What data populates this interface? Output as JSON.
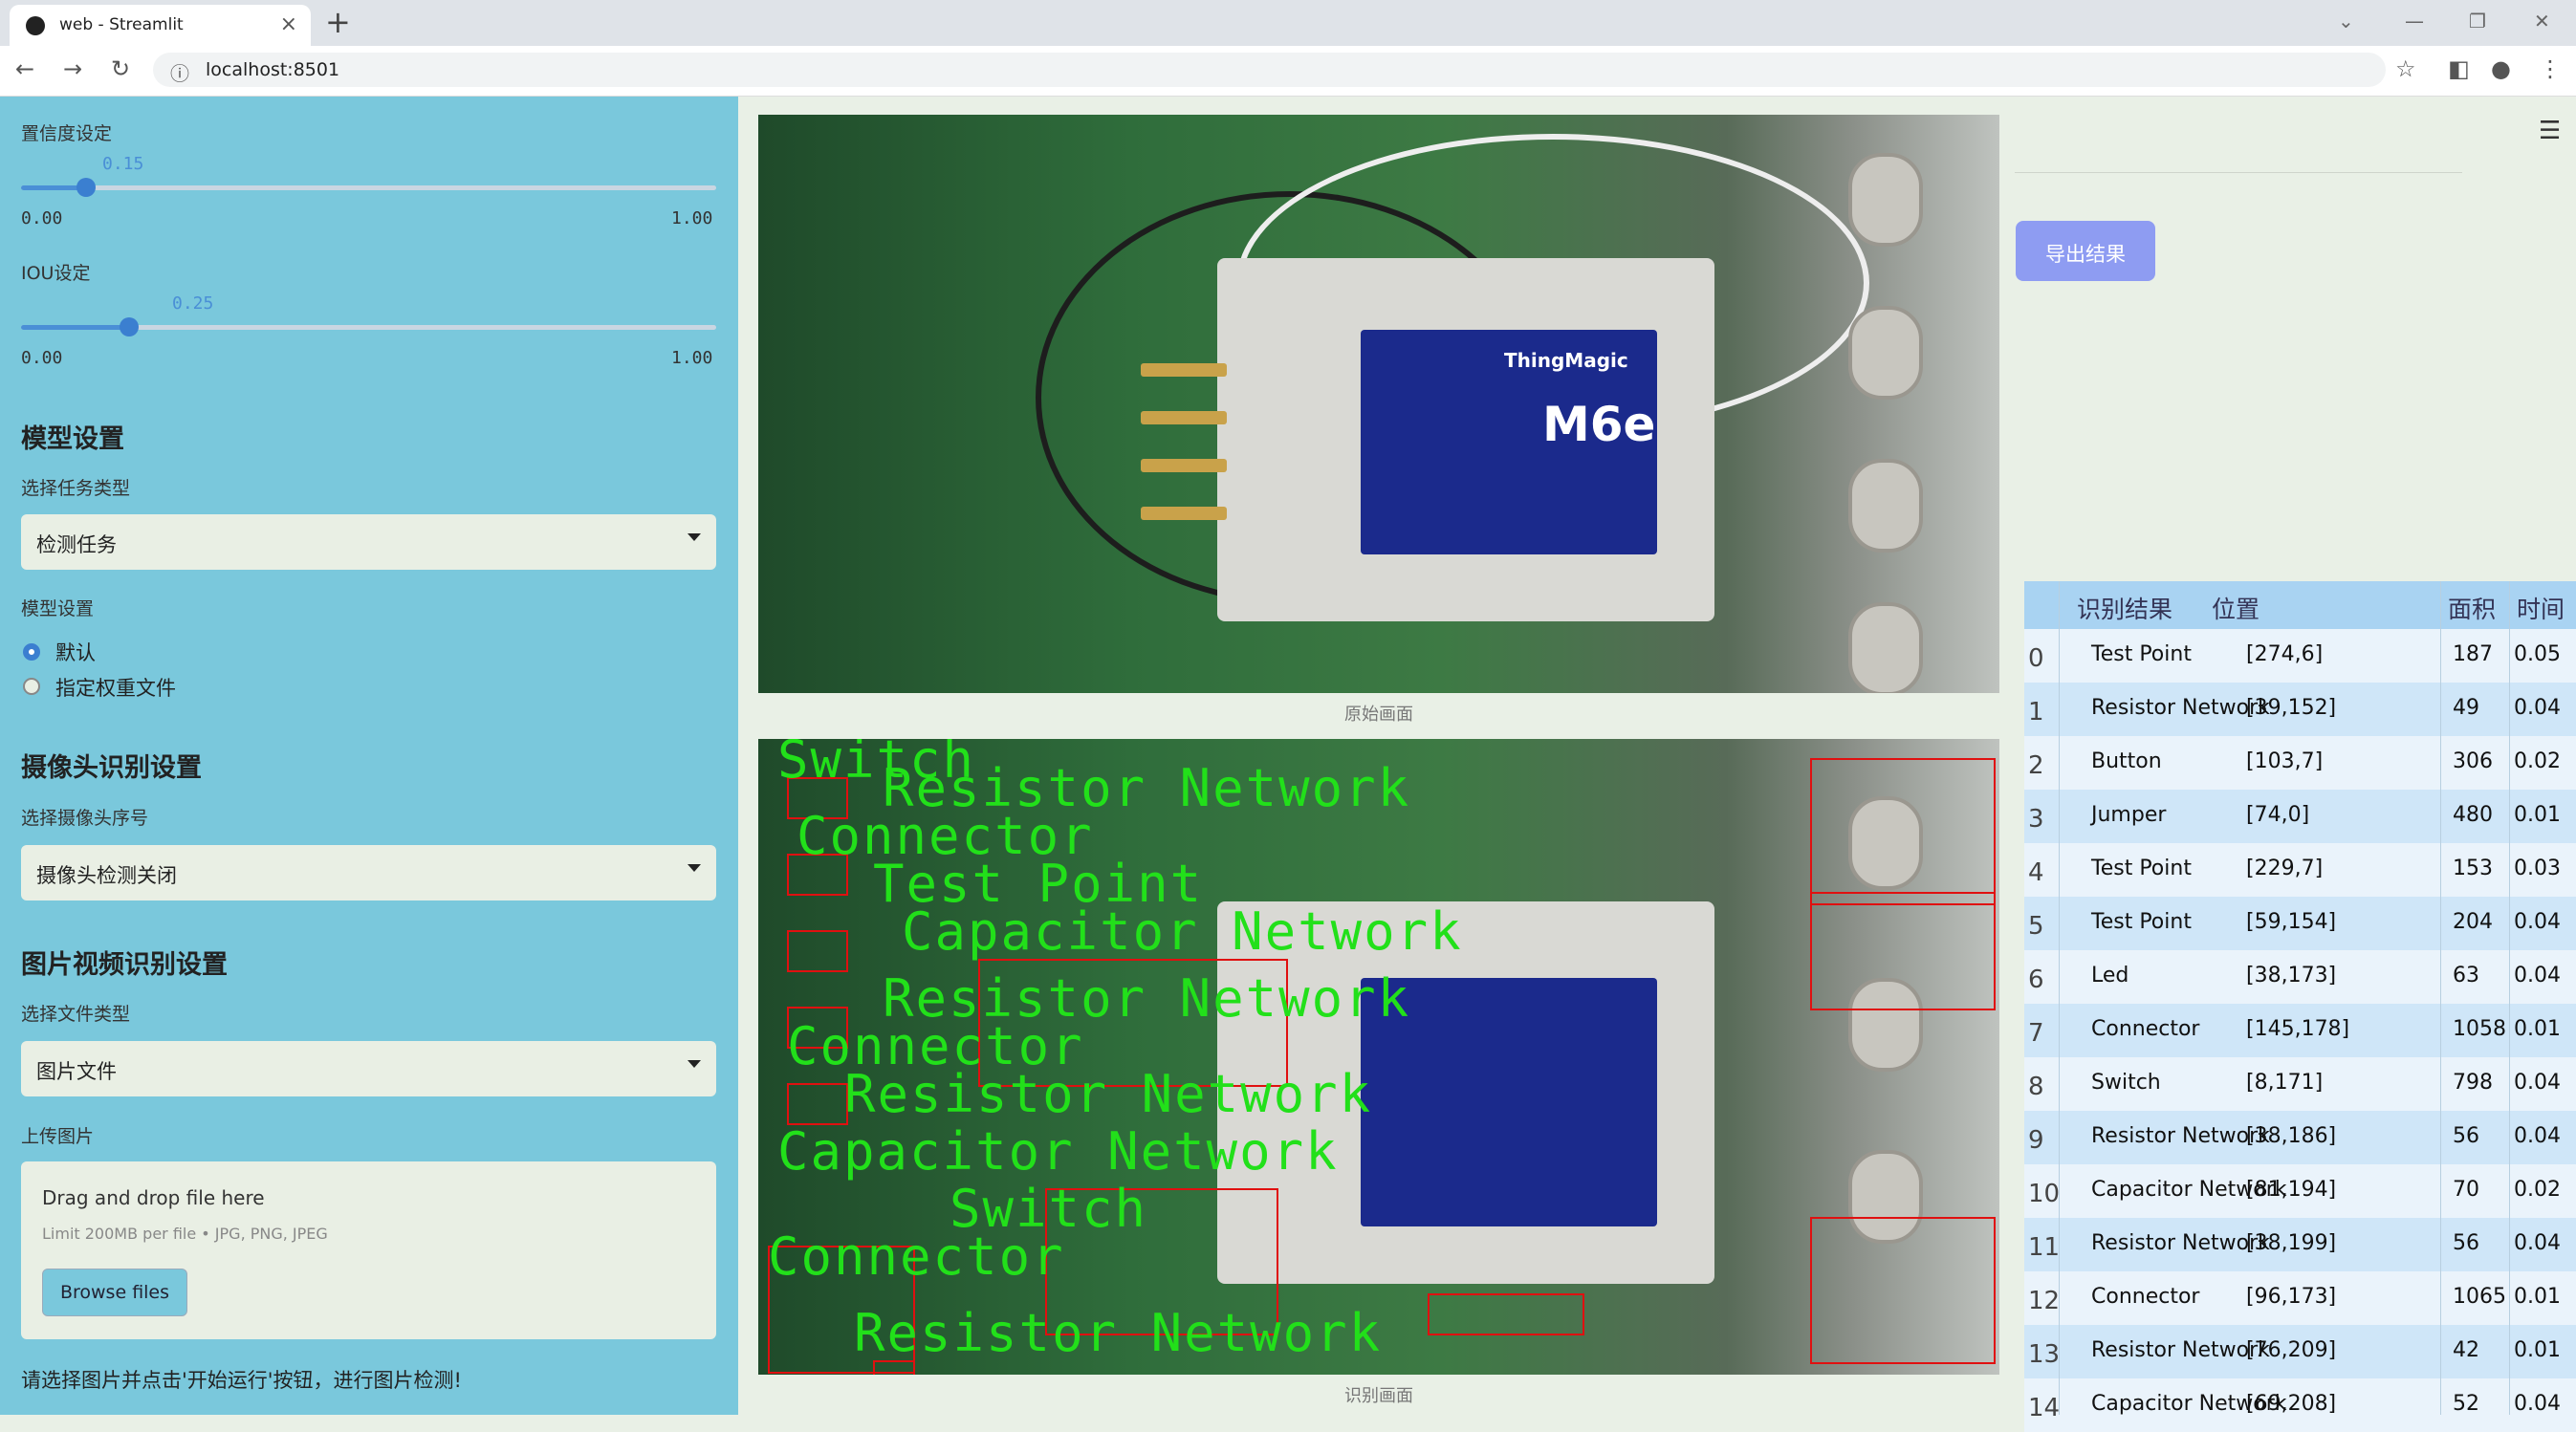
{
  "browser": {
    "tab_title": "web - Streamlit",
    "url": "localhost:8501"
  },
  "sidebar": {
    "confidence": {
      "label": "置信度设定",
      "value": "0.15",
      "value_num": 0.15,
      "min": "0.00",
      "max": "1.00"
    },
    "iou": {
      "label": "IOU设定",
      "value": "0.25",
      "value_num": 0.25,
      "min": "0.00",
      "max": "1.00"
    },
    "model_section": "模型设置",
    "task_type_label": "选择任务类型",
    "task_type_value": "检测任务",
    "model_settings_label": "模型设置",
    "radio_default": "默认",
    "radio_custom": "指定权重文件",
    "camera_section": "摄像头识别设置",
    "camera_label": "选择摄像头序号",
    "camera_value": "摄像头检测关闭",
    "media_section": "图片视频识别设置",
    "file_type_label": "选择文件类型",
    "file_type_value": "图片文件",
    "upload_label": "上传图片",
    "upload_title": "Drag and drop file here",
    "upload_limit": "Limit 200MB per file • JPG, PNG, JPEG",
    "browse_button": "Browse files",
    "hint": "请选择图片并点击'开始运行'按钮，进行图片检测!"
  },
  "main": {
    "original_caption": "原始画面",
    "result_caption": "识别画面",
    "chip_brand": "ThingMagic",
    "chip_model": "M6e",
    "detection_labels": [
      "Switch",
      "Resistor Network",
      "Connector",
      "Test Point",
      "Capacitor Network",
      "Resistor Network",
      "Connector",
      "Resistor Network",
      "Capacitor Network",
      "Switch",
      "Connector",
      "Resistor Network"
    ]
  },
  "right": {
    "export_button": "导出结果",
    "table": {
      "headers": [
        "识别结果",
        "位置",
        "面积",
        "时间"
      ],
      "rows": [
        {
          "idx": "0",
          "result": "Test Point",
          "pos": "[274,6]",
          "area": "187",
          "time": "0.05"
        },
        {
          "idx": "1",
          "result": "Resistor Network",
          "pos": "[39,152]",
          "area": "49",
          "time": "0.04"
        },
        {
          "idx": "2",
          "result": "Button",
          "pos": "[103,7]",
          "area": "306",
          "time": "0.02"
        },
        {
          "idx": "3",
          "result": "Jumper",
          "pos": "[74,0]",
          "area": "480",
          "time": "0.01"
        },
        {
          "idx": "4",
          "result": "Test Point",
          "pos": "[229,7]",
          "area": "153",
          "time": "0.03"
        },
        {
          "idx": "5",
          "result": "Test Point",
          "pos": "[59,154]",
          "area": "204",
          "time": "0.04"
        },
        {
          "idx": "6",
          "result": "Led",
          "pos": "[38,173]",
          "area": "63",
          "time": "0.04"
        },
        {
          "idx": "7",
          "result": "Connector",
          "pos": "[145,178]",
          "area": "1058",
          "time": "0.01"
        },
        {
          "idx": "8",
          "result": "Switch",
          "pos": "[8,171]",
          "area": "798",
          "time": "0.04"
        },
        {
          "idx": "9",
          "result": "Resistor Network",
          "pos": "[38,186]",
          "area": "56",
          "time": "0.04"
        },
        {
          "idx": "10",
          "result": "Capacitor Network",
          "pos": "[81,194]",
          "area": "70",
          "time": "0.02"
        },
        {
          "idx": "11",
          "result": "Resistor Network",
          "pos": "[38,199]",
          "area": "56",
          "time": "0.04"
        },
        {
          "idx": "12",
          "result": "Connector",
          "pos": "[96,173]",
          "area": "1065",
          "time": "0.01"
        },
        {
          "idx": "13",
          "result": "Resistor Network",
          "pos": "[76,209]",
          "area": "42",
          "time": "0.01"
        },
        {
          "idx": "14",
          "result": "Capacitor Network",
          "pos": "[69,208]",
          "area": "52",
          "time": "0.04"
        }
      ]
    }
  }
}
